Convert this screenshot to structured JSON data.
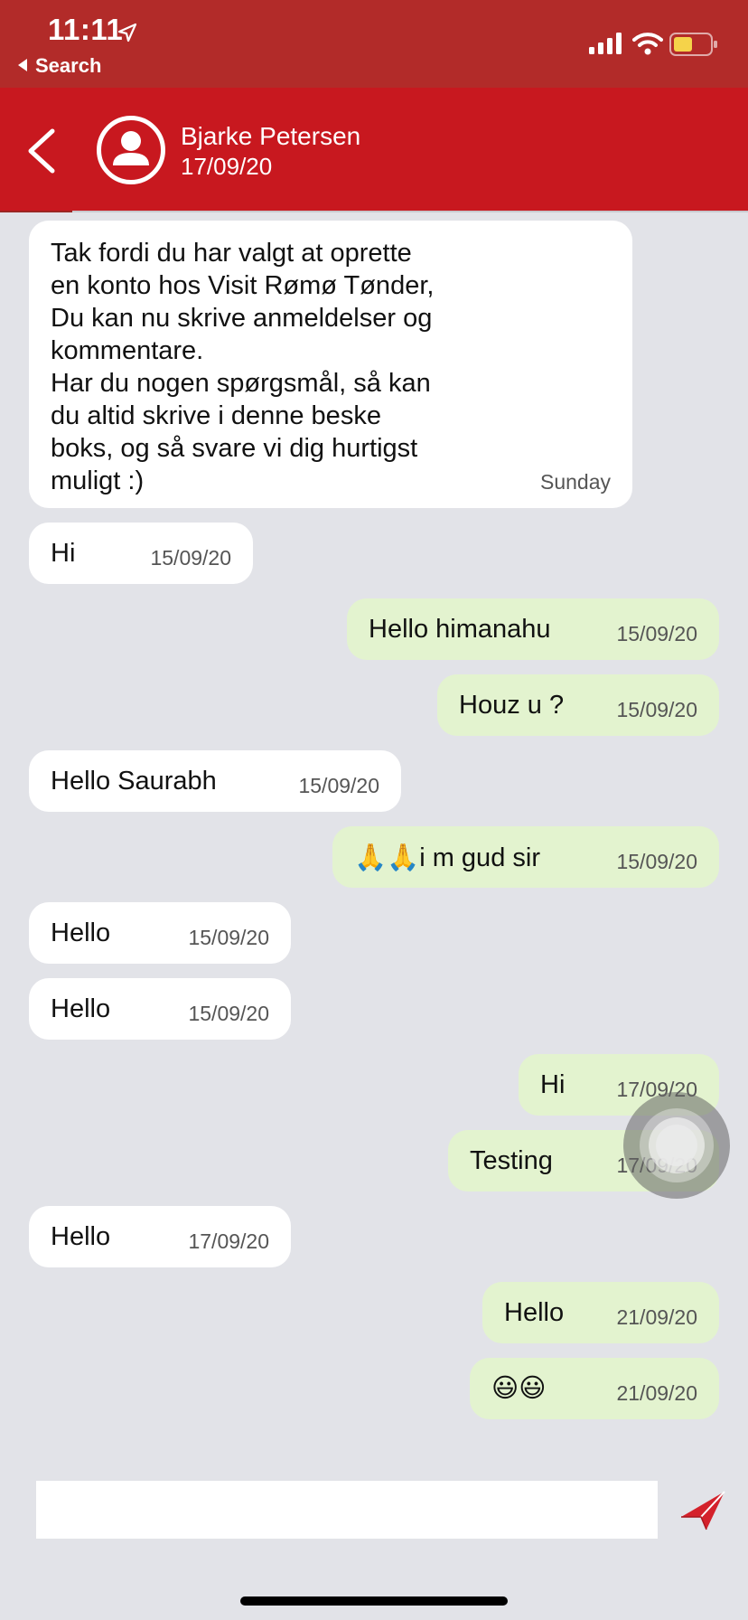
{
  "status_bar": {
    "time": "11:11",
    "back_label": "Search",
    "icons": [
      "location-arrow-icon",
      "cellular-signal-icon",
      "wifi-icon",
      "battery-low-icon"
    ]
  },
  "header": {
    "back_icon": "chevron-left-icon",
    "avatar_icon": "user-circle-icon",
    "name": "Bjarke Petersen",
    "date": "17/09/20"
  },
  "messages": [
    {
      "side": "in",
      "text": "Tak fordi du har valgt at oprette\nen konto hos Visit Rømø Tønder,\nDu kan nu skrive anmeldelser og\nkommentare.\nHar du nogen spørgsmål, så kan\ndu altid skrive i denne beske\nboks, og så svare vi dig hurtigst\nmuligt :)",
      "time": "Sunday"
    },
    {
      "side": "in",
      "text": "Hi",
      "time": "15/09/20"
    },
    {
      "side": "out",
      "text": "Hello himanahu",
      "time": "15/09/20"
    },
    {
      "side": "out",
      "text": "Houz u ?",
      "time": "15/09/20"
    },
    {
      "side": "in",
      "text": "Hello Saurabh",
      "time": "15/09/20"
    },
    {
      "side": "out",
      "text": "🙏🙏i m gud sir",
      "time": "15/09/20"
    },
    {
      "side": "in",
      "text": "Hello",
      "time": "15/09/20"
    },
    {
      "side": "in",
      "text": "Hello",
      "time": "15/09/20"
    },
    {
      "side": "out",
      "text": "Hi",
      "time": "17/09/20"
    },
    {
      "side": "out",
      "text": "Testing",
      "time": "17/09/20"
    },
    {
      "side": "in",
      "text": "Hello",
      "time": "17/09/20"
    },
    {
      "side": "out",
      "text": "Hello",
      "time": "21/09/20"
    },
    {
      "side": "out",
      "text": "😃😃",
      "time": "21/09/20"
    }
  ],
  "composer": {
    "placeholder": "",
    "send_icon": "paper-plane-send-icon"
  },
  "colors": {
    "status_bar": "#b22b29",
    "header": "#c8181f",
    "background": "#e2e3e8",
    "incoming_bubble": "#ffffff",
    "outgoing_bubble": "#e3f3cf"
  }
}
